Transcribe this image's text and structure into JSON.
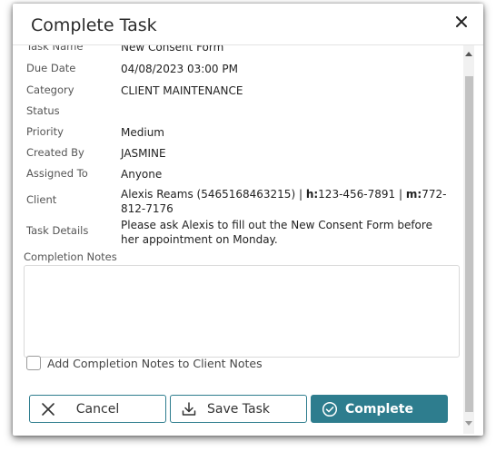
{
  "dialog": {
    "title": "Complete Task"
  },
  "fields": [
    {
      "label": "Task Name",
      "value": "New Consent Form"
    },
    {
      "label": "Due Date",
      "value": "04/08/2023 03:00 PM"
    },
    {
      "label": "Category",
      "value": "CLIENT MAINTENANCE"
    },
    {
      "label": "Status",
      "value": ""
    },
    {
      "label": "Priority",
      "value": "Medium"
    },
    {
      "label": "Created By",
      "value": "JASMINE"
    },
    {
      "label": "Assigned To",
      "value": "Anyone"
    }
  ],
  "client": {
    "label": "Client",
    "name": "Alexis Reams (5465168463215)",
    "sep": "|",
    "home_label": "h:",
    "home_phone": "123-456-7891",
    "mobile_label": "m:",
    "mobile_phone": "772-812-7176"
  },
  "details": {
    "label": "Task Details",
    "value": "Please ask Alexis to fill out the New Consent Form before her appointment on Monday."
  },
  "completion": {
    "label": "Completion Notes",
    "value": "",
    "checkbox_label": "Add Completion Notes to Client Notes",
    "checked": false
  },
  "buttons": {
    "cancel": "Cancel",
    "save": "Save Task",
    "complete": "Complete"
  },
  "colors": {
    "accent": "#2e7d8e"
  }
}
